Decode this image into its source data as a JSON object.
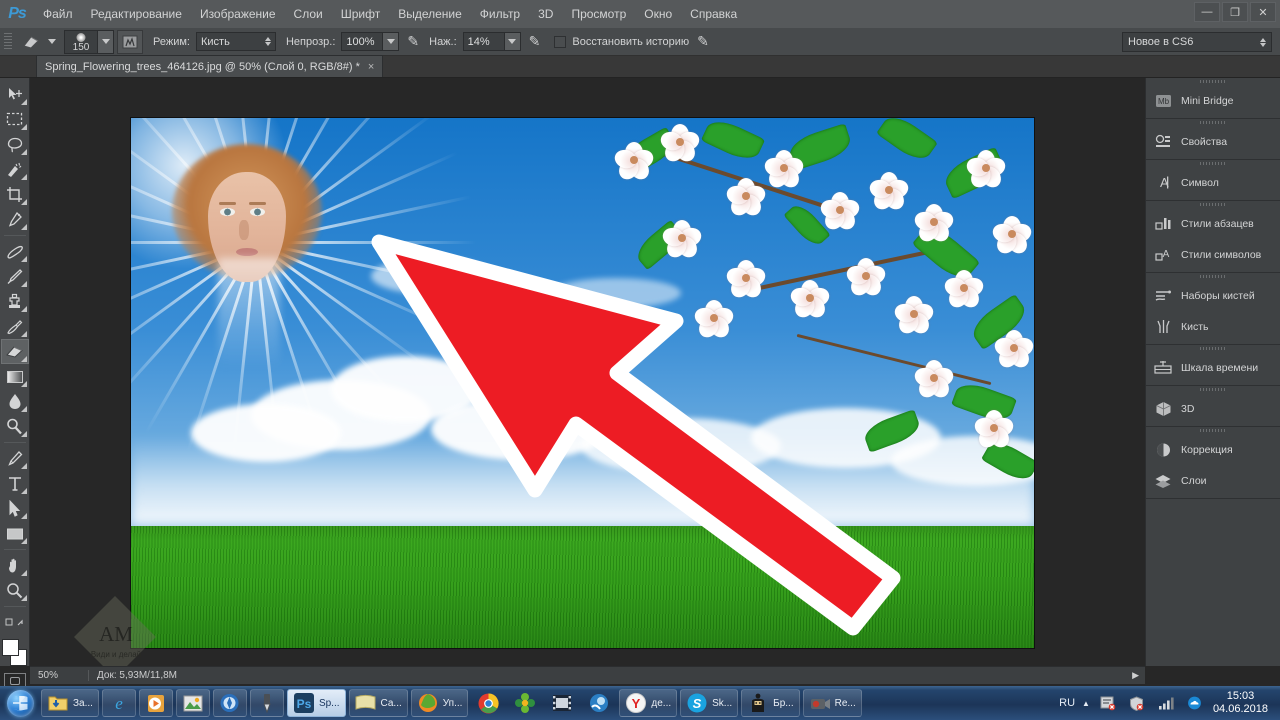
{
  "app": {
    "logo": "Ps"
  },
  "menubar": {
    "items": [
      {
        "label": "Файл"
      },
      {
        "label": "Редактирование"
      },
      {
        "label": "Изображение"
      },
      {
        "label": "Слои"
      },
      {
        "label": "Шрифт"
      },
      {
        "label": "Выделение"
      },
      {
        "label": "Фильтр"
      },
      {
        "label": "3D"
      },
      {
        "label": "Просмотр"
      },
      {
        "label": "Окно"
      },
      {
        "label": "Справка"
      }
    ],
    "window_controls": {
      "minimize": "—",
      "restore": "❐",
      "close": "✕"
    }
  },
  "optionsbar": {
    "brush_size": "150",
    "mode_label": "Режим:",
    "mode_value": "Кисть",
    "opacity_label": "Непрозр.:",
    "opacity_value": "100%",
    "flow_label": "Наж.:",
    "flow_value": "14%",
    "erase_history_label": "Восстановить историю",
    "workspace": "Новое в CS6"
  },
  "document_tab": {
    "title": "Spring_Flowering_trees_464126.jpg @ 50% (Слой 0, RGB/8#) *",
    "close": "×"
  },
  "toolbar": {
    "tools": [
      {
        "name": "move-tool",
        "title": "Перемещение"
      },
      {
        "name": "marquee-tool",
        "title": "Прямоугольная область"
      },
      {
        "name": "lasso-tool",
        "title": "Лассо"
      },
      {
        "name": "quick-selection-tool",
        "title": "Быстрое выделение"
      },
      {
        "name": "crop-tool",
        "title": "Рамка"
      },
      {
        "name": "eyedropper-tool",
        "title": "Пипетка"
      },
      {
        "name": "healing-brush-tool",
        "title": "Восстанавливающая кисть"
      },
      {
        "name": "brush-tool",
        "title": "Кисть"
      },
      {
        "name": "clone-stamp-tool",
        "title": "Штамп"
      },
      {
        "name": "history-brush-tool",
        "title": "Архивная кисть"
      },
      {
        "name": "eraser-tool",
        "title": "Ластик",
        "active": true
      },
      {
        "name": "gradient-tool",
        "title": "Градиент"
      },
      {
        "name": "blur-tool",
        "title": "Размытие"
      },
      {
        "name": "dodge-tool",
        "title": "Осветлитель"
      },
      {
        "name": "pen-tool",
        "title": "Перо"
      },
      {
        "name": "type-tool",
        "title": "Текст"
      },
      {
        "name": "path-selection-tool",
        "title": "Выделение контура"
      },
      {
        "name": "rectangle-tool",
        "title": "Прямоугольник"
      },
      {
        "name": "hand-tool",
        "title": "Рука"
      },
      {
        "name": "zoom-tool",
        "title": "Масштаб"
      }
    ],
    "foreground_color": "#ffffff",
    "background_color": "#ffffff"
  },
  "statusbar": {
    "zoom": "50%",
    "doc_info": "Док: 5,93M/11,8M",
    "expand_arrow": "▶"
  },
  "dock": {
    "groups": [
      {
        "items": [
          {
            "label": "Mini Bridge",
            "icon": "mini-bridge-icon"
          }
        ]
      },
      {
        "items": [
          {
            "label": "Свойства",
            "icon": "properties-icon"
          }
        ]
      },
      {
        "items": [
          {
            "label": "Символ",
            "icon": "character-icon"
          }
        ]
      },
      {
        "items": [
          {
            "label": "Стили абзацев",
            "icon": "paragraph-styles-icon"
          },
          {
            "label": "Стили символов",
            "icon": "character-styles-icon"
          }
        ]
      },
      {
        "items": [
          {
            "label": "Наборы кистей",
            "icon": "brush-presets-icon"
          },
          {
            "label": "Кисть",
            "icon": "brush-panel-icon"
          }
        ]
      },
      {
        "items": [
          {
            "label": "Шкала времени",
            "icon": "timeline-icon"
          }
        ]
      },
      {
        "items": [
          {
            "label": "3D",
            "icon": "cube-3d-icon"
          }
        ]
      },
      {
        "items": [
          {
            "label": "Коррекция",
            "icon": "adjustments-icon"
          },
          {
            "label": "Слои",
            "icon": "layers-icon"
          }
        ]
      }
    ]
  },
  "canvas": {
    "annotation": {
      "shape": "arrow",
      "color": "#ed1c24",
      "outline": "#ffffff",
      "direction": "up-left"
    },
    "image_description": "Spring flowering trees — cherry blossom branches, blue sky, green grass, woman's face with sun rays"
  },
  "watermark": {
    "initials": "АМ",
    "subtitle": "Види и делай"
  },
  "taskbar": {
    "start": "start-orb",
    "buttons": [
      {
        "label": "За...",
        "icon": "downloads-folder-icon",
        "active": false
      },
      {
        "label": "",
        "icon": "internet-explorer-icon",
        "active": false
      },
      {
        "label": "",
        "icon": "media-player-icon",
        "active": false
      },
      {
        "label": "",
        "icon": "photo-viewer-icon",
        "active": false
      },
      {
        "label": "",
        "icon": "media-center-icon",
        "active": false
      },
      {
        "label": "",
        "icon": "pen-app-icon",
        "active": false
      },
      {
        "label": "Sp...",
        "icon": "photoshop-icon",
        "active": true
      },
      {
        "label": "Са...",
        "icon": "notes-icon",
        "active": false
      },
      {
        "label": "Уп...",
        "icon": "firefox-icon",
        "active": false
      },
      {
        "label": "",
        "icon": "chrome-icon",
        "active": false
      },
      {
        "label": "",
        "icon": "flower-app-icon",
        "active": false
      },
      {
        "label": "",
        "icon": "video-editor-icon",
        "active": false
      },
      {
        "label": "",
        "icon": "blue-app-icon",
        "active": false
      },
      {
        "label": "де...",
        "icon": "yandex-icon",
        "active": false
      },
      {
        "label": "Sk...",
        "icon": "skype-icon",
        "active": false
      },
      {
        "label": "Бр...",
        "icon": "bearded-app-icon",
        "active": false
      },
      {
        "label": "Re...",
        "icon": "camera-recorder-icon",
        "active": false
      }
    ],
    "tray": {
      "language": "RU",
      "show_hidden": "▲",
      "icons": [
        "antivirus-icon",
        "security-icon",
        "network-icon",
        "cloud-icon"
      ],
      "time": "15:03",
      "date": "04.06.2018"
    }
  }
}
